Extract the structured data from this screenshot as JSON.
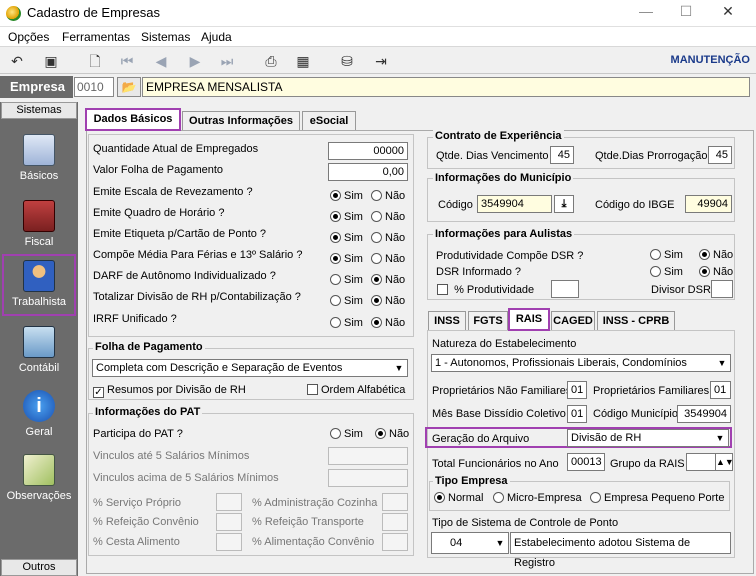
{
  "window": {
    "title": "Cadastro de Empresas"
  },
  "menu": [
    {
      "label": "Opções"
    },
    {
      "label": "Ferramentas"
    },
    {
      "label": "Sistemas"
    },
    {
      "label": "Ajuda"
    }
  ],
  "toolbar": {
    "mode": "MANUTENÇÃO"
  },
  "empresa": {
    "label": "Empresa",
    "code": "0010",
    "name": "EMPRESA MENSALISTA"
  },
  "sidebar": {
    "header": "Sistemas",
    "footer": "Outros",
    "items": [
      {
        "label": "Básicos"
      },
      {
        "label": "Fiscal"
      },
      {
        "label": "Trabalhista"
      },
      {
        "label": "Contábil"
      },
      {
        "label": "Geral"
      },
      {
        "label": "Observações"
      }
    ]
  },
  "tabs": [
    {
      "label": "Dados Básicos"
    },
    {
      "label": "Outras Informações"
    },
    {
      "label": "eSocial"
    }
  ],
  "dados": {
    "qtd_label": "Quantidade Atual de Empregados",
    "qtd_value": "00000",
    "folha_label": "Valor Folha de Pagamento",
    "folha_value": "0,00",
    "sim": "Sim",
    "nao": "Não",
    "questions": [
      {
        "label": "Emite Escala de Revezamento ?",
        "value": "Sim"
      },
      {
        "label": "Emite Quadro de Horário ?",
        "value": "Sim"
      },
      {
        "label": "Emite Etiqueta p/Cartão de Ponto ?",
        "value": "Sim"
      },
      {
        "label": "Compõe Média Para Férias e 13º Salário ?",
        "value": "Sim"
      },
      {
        "label": "DARF de Autônomo Individualizado ?",
        "value": "Não"
      },
      {
        "label": "Totalizar Divisão de RH p/Contabilização ?",
        "value": "Não"
      },
      {
        "label": "IRRF Unificado ?",
        "value": "Não"
      }
    ]
  },
  "folha": {
    "title": "Folha de Pagamento",
    "select": "Completa com Descrição e Separação de Eventos",
    "resumos": "Resumos por Divisão de RH",
    "ordem": "Ordem Alfabética"
  },
  "pat": {
    "title": "Informações do PAT",
    "participa": "Participa do PAT ?",
    "ate5": "Vinculos até 5 Salários Mínimos",
    "acima5": "Vinculos acima de 5 Salários Mínimos",
    "servico": "% Serviço Próprio",
    "admin": "% Administração Cozinha",
    "refeicao": "% Refeição Convênio",
    "ref_transp": "% Refeição Transporte",
    "cesta": "% Cesta Alimento",
    "alim": "% Alimentação Convênio"
  },
  "contrato": {
    "title": "Contrato de Experiência",
    "venc_label": "Qtde. Dias Vencimento",
    "venc_value": "45",
    "prorr_label": "Qtde.Dias Prorrogação",
    "prorr_value": "45"
  },
  "municipio": {
    "title": "Informações do Município",
    "codigo_label": "Código",
    "codigo_value": "3549904",
    "ibge_label": "Código do IBGE",
    "ibge_value": "49904"
  },
  "aulistas": {
    "title": "Informações para Aulistas",
    "dsr_label": "Produtividade Compõe DSR ?",
    "dsr_inf_label": "DSR Informado ?",
    "prod_label": "% Produtividade",
    "divisor_label": "Divisor DSR"
  },
  "subtabs": [
    {
      "label": "INSS"
    },
    {
      "label": "FGTS"
    },
    {
      "label": "RAIS"
    },
    {
      "label": "CAGED"
    },
    {
      "label": "INSS - CPRB"
    }
  ],
  "rais": {
    "natureza_label": "Natureza do Estabelecimento",
    "natureza_value": "1 - Autonomos, Profissionais Liberais, Condomínios",
    "prop_nf_label": "Proprietários Não Familiares",
    "prop_nf_value": "01",
    "prop_f_label": "Proprietários Familiares",
    "prop_f_value": "01",
    "mes_label": "Mês Base Dissídio Coletivo",
    "mes_value": "01",
    "cod_mun_label": "Código Município",
    "cod_mun_value": "3549904",
    "geracao_label": "Geração do  Arquivo",
    "geracao_value": "Divisão de RH",
    "total_label": "Total Funcionários no Ano",
    "total_value": "00013",
    "grupo_label": "Grupo da RAIS",
    "tipo_title": "Tipo Empresa",
    "tipo_options": [
      "Normal",
      "Micro-Empresa",
      "Empresa Pequeno Porte"
    ],
    "ponto_label": "Tipo de Sistema de Controle de Ponto",
    "ponto_value": "04",
    "ponto_desc": "Estabelecimento adotou Sistema de Registro"
  }
}
